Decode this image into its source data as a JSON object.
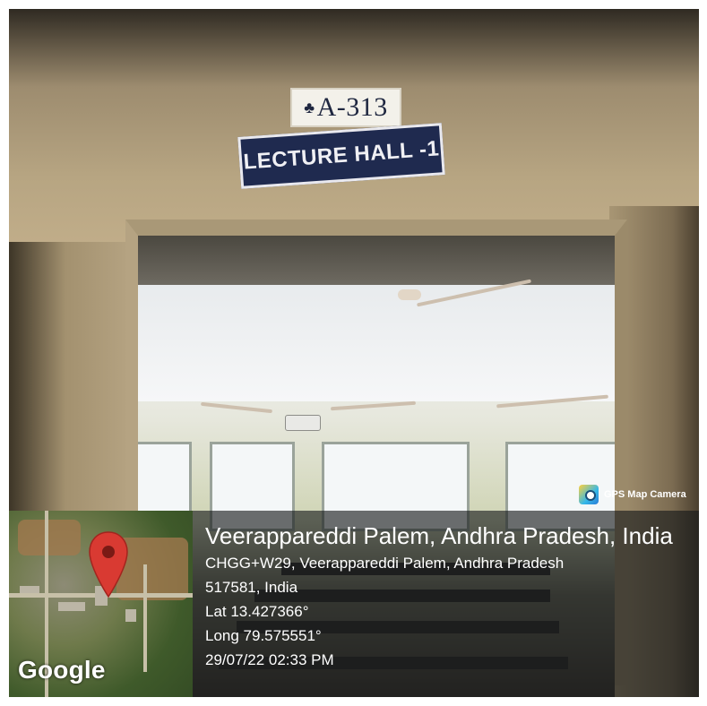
{
  "scene": {
    "room_number": "A-313",
    "room_name": "LECTURE HALL -1"
  },
  "camera_app": {
    "name": "GPS Map Camera",
    "icon": "gps-map-camera-icon"
  },
  "map": {
    "brand": "Google",
    "pin_icon": "location-pin-icon",
    "pin_color": "#d93a32"
  },
  "location": {
    "place": "Veerappareddi Palem, Andhra Pradesh, India",
    "address_line1": "CHGG+W29, Veerappareddi Palem, Andhra Pradesh",
    "address_line2": "517581, India",
    "latitude": "Lat 13.427366°",
    "longitude": "Long 79.575551°",
    "timestamp": "29/07/22 02:33 PM"
  }
}
